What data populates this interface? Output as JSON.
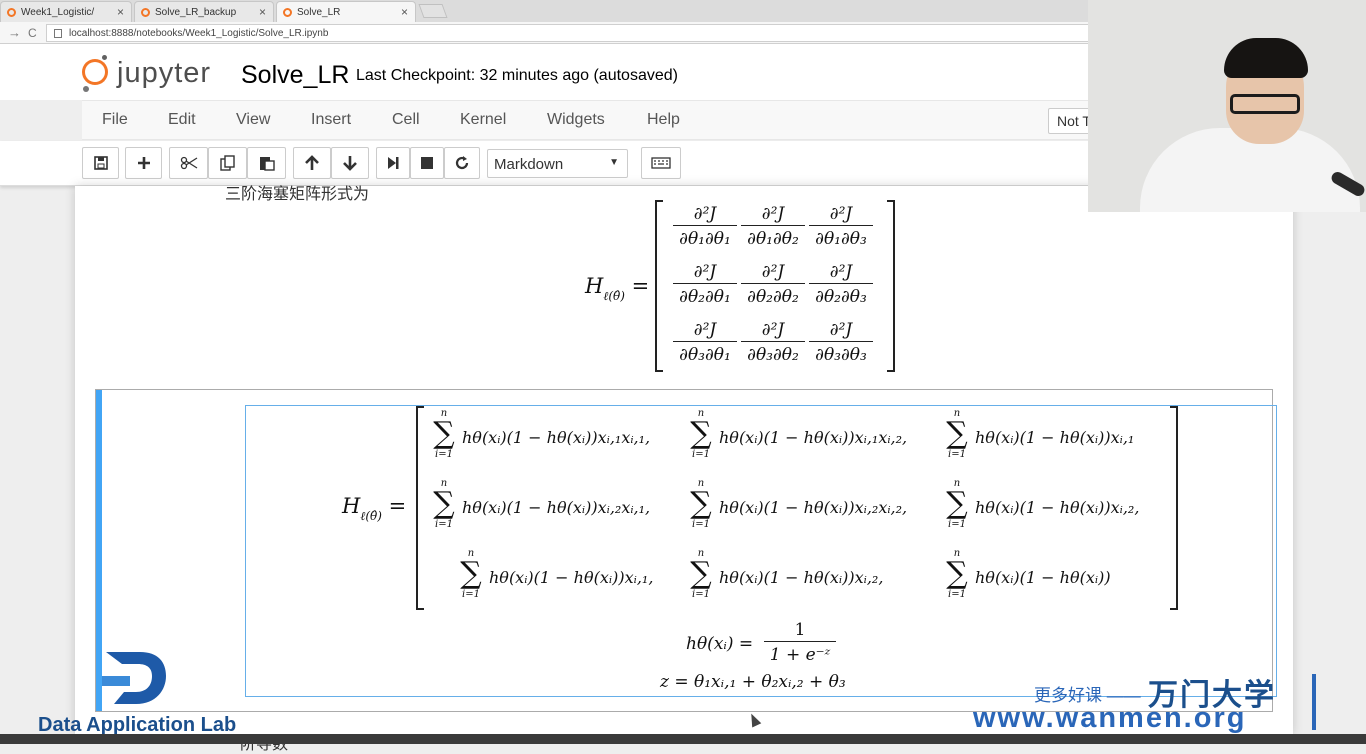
{
  "browser": {
    "tabs": [
      {
        "label": "Week1_Logistic/",
        "close": "×"
      },
      {
        "label": "Solve_LR_backup",
        "close": "×"
      },
      {
        "label": "Solve_LR",
        "close": "×"
      }
    ],
    "back": "→",
    "reload": "C",
    "url": "localhost:8888/notebooks/Week1_Logistic/Solve_LR.ipynb"
  },
  "header": {
    "logo_text": "jupyter",
    "notebook_name": "Solve_LR",
    "checkpoint": "Last Checkpoint: 32 minutes ago (autosaved)",
    "trusted": "Not T"
  },
  "menu": [
    "File",
    "Edit",
    "View",
    "Insert",
    "Cell",
    "Kernel",
    "Widgets",
    "Help"
  ],
  "toolbar": {
    "cell_type": "Markdown",
    "caret": "▼"
  },
  "content": {
    "cell1_text": "三阶海塞矩阵形式为",
    "hessian_label": "H",
    "hessian_sub": "ℓ(θ̂)",
    "equals": "=",
    "matrix1": [
      [
        "∂²J",
        "∂θ₁∂θ₁",
        "∂²J",
        "∂θ₁∂θ₂",
        "∂²J",
        "∂θ₁∂θ₃"
      ],
      [
        "∂²J",
        "∂θ₂∂θ₁",
        "∂²J",
        "∂θ₂∂θ₂",
        "∂²J",
        "∂θ₂∂θ₃"
      ],
      [
        "∂²J",
        "∂θ₃∂θ₁",
        "∂²J",
        "∂θ₃∂θ₂",
        "∂²J",
        "∂θ₃∂θ₃"
      ]
    ],
    "sigma_top": "n",
    "sigma_sym": "∑",
    "sigma_bot": "i=1",
    "matrix2": [
      [
        "hθ(xᵢ)(1 − hθ(xᵢ))xᵢ,₁xᵢ,₁,",
        "hθ(xᵢ)(1 − hθ(xᵢ))xᵢ,₁xᵢ,₂,",
        "hθ(xᵢ)(1 − hθ(xᵢ))xᵢ,₁"
      ],
      [
        "hθ(xᵢ)(1 − hθ(xᵢ))xᵢ,₂xᵢ,₁,",
        "hθ(xᵢ)(1 − hθ(xᵢ))xᵢ,₂xᵢ,₂,",
        "hθ(xᵢ)(1 − hθ(xᵢ))xᵢ,₂,"
      ],
      [
        "hθ(xᵢ)(1 − hθ(xᵢ))xᵢ,₁,",
        "hθ(xᵢ)(1 − hθ(xᵢ))xᵢ,₂,",
        "hθ(xᵢ)(1 − hθ(xᵢ))"
      ]
    ],
    "h_def_lhs": "hθ(xᵢ) =",
    "h_def_num": "1",
    "h_def_den": "1 + e⁻ᶻ",
    "z_def": "z = θ₁xᵢ,₁ + θ₂xᵢ,₂ + θ₃",
    "next_text": "一阶导数"
  },
  "watermark": {
    "lab": "Data Application Lab",
    "cn_slogan": "更多好课 ——",
    "brand": "万门大学",
    "url": "www.wanmen.org"
  },
  "colors": {
    "jupyter_orange": "#f37626",
    "selected_bar": "#42a5f5",
    "editor_border": "#66afe9",
    "watermark_blue": "#2a66b8"
  }
}
